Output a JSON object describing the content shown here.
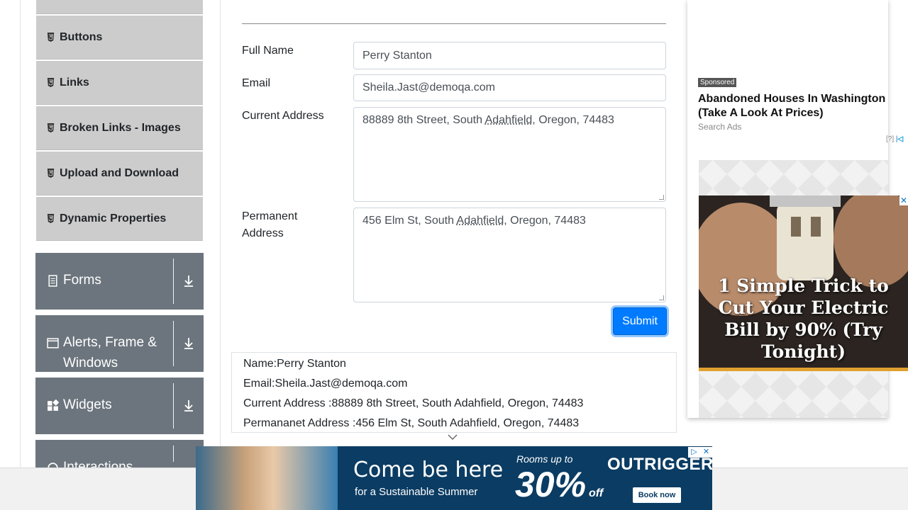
{
  "sidebar": {
    "items": [
      {
        "label": "Buttons"
      },
      {
        "label": "Links"
      },
      {
        "label": "Broken Links - Images"
      },
      {
        "label": "Upload and Download"
      },
      {
        "label": "Dynamic Properties"
      }
    ],
    "groups": [
      {
        "label": "Forms",
        "icon": "document-icon"
      },
      {
        "label": "Alerts, Frame & Windows",
        "icon": "window-icon"
      },
      {
        "label": "Widgets",
        "icon": "widgets-icon"
      },
      {
        "label": "Interactions",
        "icon": "interactions-icon"
      }
    ]
  },
  "form": {
    "labels": {
      "full_name": "Full Name",
      "email": "Email",
      "current_address": "Current Address",
      "permanent_address": "Permanent Address"
    },
    "values": {
      "full_name": "Perry Stanton",
      "email": "Sheila.Jast@demoqa.com",
      "current_address_pre": "88889 8th Street, South ",
      "current_address_word": "Adahfield",
      "current_address_post": ", Oregon, 74483",
      "permanent_address_pre": "456 Elm St, South ",
      "permanent_address_word": "Adahfield",
      "permanent_address_post": ", Oregon, 74483"
    },
    "submit_label": "Submit"
  },
  "output": {
    "lines": [
      "Name:Perry Stanton",
      "Email:Sheila.Jast@demoqa.com",
      "Current Address :88889 8th Street, South Adahfield, Oregon, 74483",
      "Permananet Address :456 Elm St, South Adahfield, Oregon, 74483"
    ]
  },
  "right_ad": {
    "sponsored": "Sponsored",
    "title": "Abandoned Houses In Washington (Take A Look At Prices)",
    "source": "Search Ads",
    "help": "[?]",
    "video_caption": "1 Simple Trick to Cut Your Electric Bill by 90% (Try Tonight)"
  },
  "bottom_ad": {
    "headline": "Come be here",
    "subline": "for a Sustainable Summer",
    "rooms": "Rooms up to",
    "percent": "30%",
    "off": "off",
    "brand": "OUTRIGGER.",
    "cta": "Book now"
  },
  "colors": {
    "primary": "#007bff",
    "group_bg": "#6c757d",
    "item_bg": "#cccccc",
    "banner_bg": "#0b3c63"
  }
}
